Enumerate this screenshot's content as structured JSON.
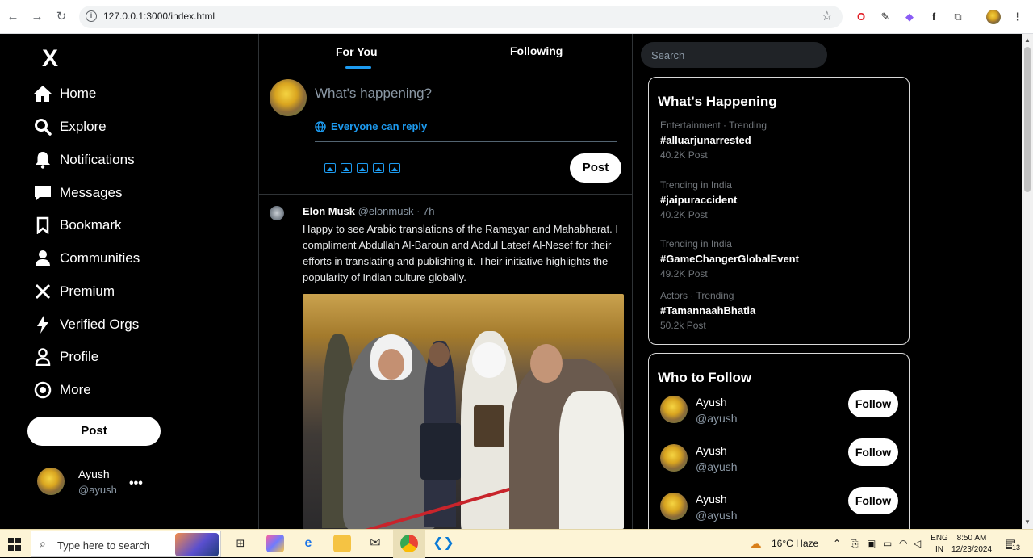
{
  "browser": {
    "url": "127.0.0.1:3000/index.html"
  },
  "sidebar": {
    "logo": "X",
    "items": [
      {
        "label": "Home",
        "icon": "home-icon"
      },
      {
        "label": "Explore",
        "icon": "search-icon"
      },
      {
        "label": "Notifications",
        "icon": "bell-icon"
      },
      {
        "label": "Messages",
        "icon": "message-icon"
      },
      {
        "label": "Bookmark",
        "icon": "bookmark-icon"
      },
      {
        "label": "Communities",
        "icon": "people-icon"
      },
      {
        "label": "Premium",
        "icon": "x-icon"
      },
      {
        "label": "Verified Orgs",
        "icon": "lightning-icon"
      },
      {
        "label": "Profile",
        "icon": "person-icon"
      },
      {
        "label": "More",
        "icon": "more-circle-icon"
      }
    ],
    "post_label": "Post",
    "user": {
      "name": "Ayush",
      "handle": "@ayush",
      "more": "•••"
    }
  },
  "feed": {
    "tabs": [
      "For You",
      "Following"
    ],
    "composer": {
      "placeholder": "What's happening?",
      "reply_setting": "Everyone can reply",
      "post_label": "Post"
    },
    "tweet": {
      "name": "Elon Musk",
      "handle": "@elonmusk · 7h",
      "text": "Happy to see Arabic translations of the Ramayan and Mahabharat. I compliment Abdullah Al-Baroun and Abdul Lateef Al-Nesef for their efforts in translating and publishing it. Their initiative highlights the popularity of Indian culture globally."
    }
  },
  "right": {
    "search_placeholder": "Search",
    "happening": {
      "title": "What's Happening",
      "trends": [
        {
          "meta": "Entertainment · Trending",
          "tag": "#alluarjunarrested",
          "count": "40.2K Post"
        },
        {
          "meta": "Trending in India",
          "tag": "#jaipuraccident",
          "count": "40.2K Post"
        },
        {
          "meta": "Trending in India",
          "tag": "#GameChangerGlobalEvent",
          "count": "49.2K Post"
        },
        {
          "meta": "Actors · Trending",
          "tag": "#TamannaahBhatia",
          "count": "50.2k Post"
        }
      ]
    },
    "follow": {
      "title": "Who to Follow",
      "users": [
        {
          "name": "Ayush",
          "handle": "@ayush",
          "button": "Follow"
        },
        {
          "name": "Ayush",
          "handle": "@ayush",
          "button": "Follow"
        },
        {
          "name": "Ayush",
          "handle": "@ayush",
          "button": "Follow"
        }
      ]
    }
  },
  "taskbar": {
    "search_placeholder": "Type here to search",
    "weather": "16°C  Haze",
    "lang_top": "ENG",
    "lang_bottom": "IN",
    "time": "8:50 AM",
    "date": "12/23/2024",
    "notif_count": "13"
  }
}
